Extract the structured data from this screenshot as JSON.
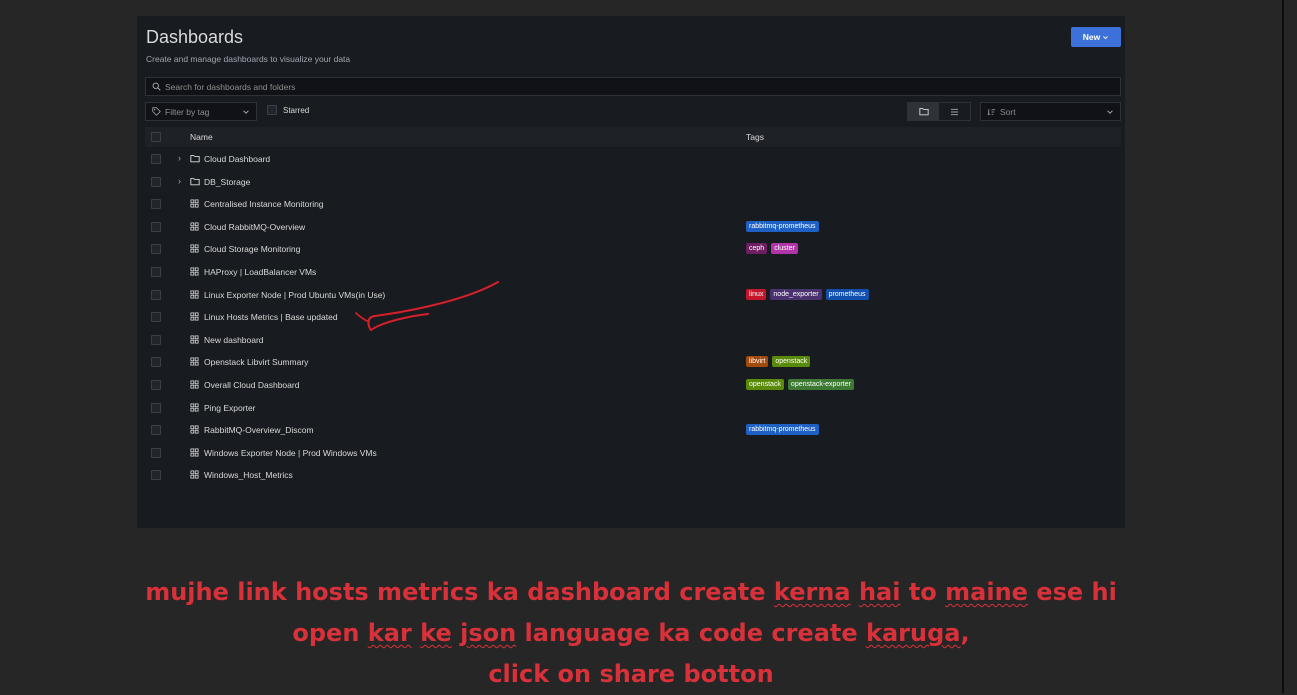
{
  "page": {
    "title": "Dashboards",
    "subtitle": "Create and manage dashboards to visualize your data",
    "new_button": "New"
  },
  "search": {
    "placeholder": "Search for dashboards and folders"
  },
  "filters": {
    "tag_filter": "Filter by tag",
    "starred_label": "Starred",
    "sort_label": "Sort"
  },
  "table": {
    "headers": {
      "name": "Name",
      "tags": "Tags"
    },
    "rows": [
      {
        "type": "folder",
        "name": "Cloud Dashboard",
        "tags": []
      },
      {
        "type": "folder",
        "name": "DB_Storage",
        "tags": []
      },
      {
        "type": "dashboard",
        "name": "Centralised Instance Monitoring",
        "tags": []
      },
      {
        "type": "dashboard",
        "name": "Cloud RabbitMQ-Overview",
        "tags": [
          {
            "text": "rabbitmq-prometheus",
            "color": "#1f60c4"
          }
        ]
      },
      {
        "type": "dashboard",
        "name": "Cloud Storage Monitoring",
        "tags": [
          {
            "text": "ceph",
            "color": "#6d1f62"
          },
          {
            "text": "cluster",
            "color": "#b035a8"
          }
        ]
      },
      {
        "type": "dashboard",
        "name": "HAProxy | LoadBalancer VMs",
        "tags": []
      },
      {
        "type": "dashboard",
        "name": "Linux Exporter Node | Prod Ubuntu VMs(in Use)",
        "tags": [
          {
            "text": "linux",
            "color": "#c4162a"
          },
          {
            "text": "node_exporter",
            "color": "#4a3270"
          },
          {
            "text": "prometheus",
            "color": "#1250b0"
          }
        ]
      },
      {
        "type": "dashboard",
        "name": "Linux Hosts Metrics | Base updated",
        "tags": []
      },
      {
        "type": "dashboard",
        "name": "New dashboard",
        "tags": []
      },
      {
        "type": "dashboard",
        "name": "Openstack Libvirt Summary",
        "tags": [
          {
            "text": "libvirt",
            "color": "#a34a0e"
          },
          {
            "text": "openstack",
            "color": "#5a8a0a"
          }
        ]
      },
      {
        "type": "dashboard",
        "name": "Overall Cloud Dashboard",
        "tags": [
          {
            "text": "openstack",
            "color": "#5a8a0a"
          },
          {
            "text": "openstack-exporter",
            "color": "#3e7a34"
          }
        ]
      },
      {
        "type": "dashboard",
        "name": "Ping Exporter",
        "tags": []
      },
      {
        "type": "dashboard",
        "name": "RabbitMQ-Overview_Discom",
        "tags": [
          {
            "text": "rabbitmq-prometheus",
            "color": "#1f60c4"
          }
        ]
      },
      {
        "type": "dashboard",
        "name": "Windows Exporter Node | Prod Windows VMs",
        "tags": []
      },
      {
        "type": "dashboard",
        "name": "Windows_Host_Metrics",
        "tags": []
      }
    ]
  },
  "annotation": {
    "line1": [
      "mujhe link hosts metrics ka dashboard create ",
      "kerna",
      " ",
      "hai",
      " to ",
      "maine",
      " ese hi"
    ],
    "line2": [
      "open ",
      "kar",
      " ",
      "ke",
      " ",
      "json",
      " language ka code create ",
      "karuga",
      ","
    ],
    "line3": "click on share botton",
    "color": "#d9313a"
  },
  "colors": {
    "accent": "#3d71d9",
    "panel_bg": "#181b1f",
    "page_bg": "#262626"
  }
}
